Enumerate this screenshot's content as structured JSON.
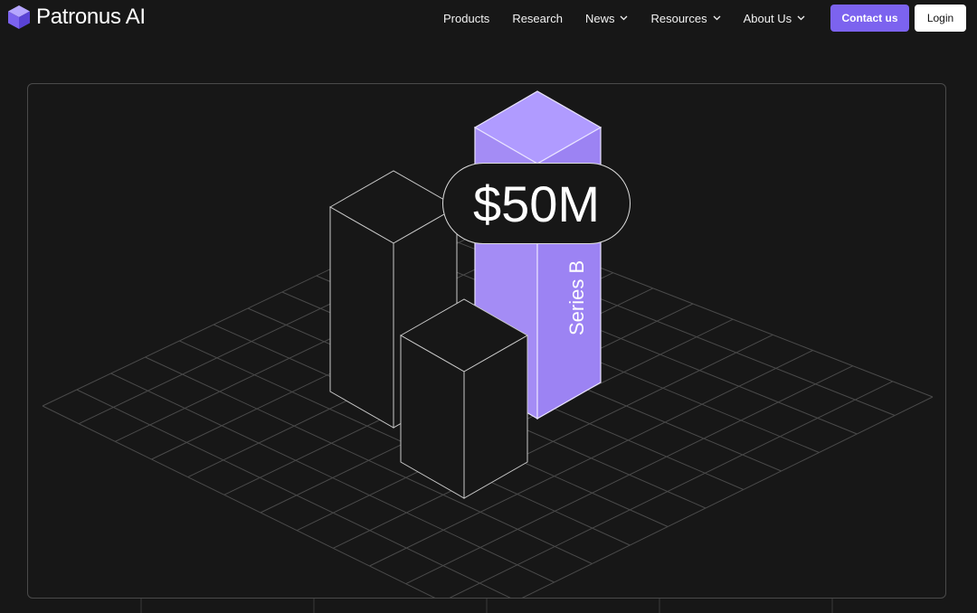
{
  "brand": {
    "name": "Patronus AI",
    "logo_icon": "purple-cube-icon",
    "accent_color": "#7c63ef"
  },
  "nav": {
    "items": [
      {
        "label": "Products",
        "has_dropdown": false
      },
      {
        "label": "Research",
        "has_dropdown": false
      },
      {
        "label": "News",
        "has_dropdown": true
      },
      {
        "label": "Resources",
        "has_dropdown": true
      },
      {
        "label": "About Us",
        "has_dropdown": true
      }
    ],
    "contact_label": "Contact us",
    "login_label": "Login"
  },
  "hero": {
    "amount": "$50M",
    "round_label": "Series B",
    "highlight_color": "#a48cf5",
    "background_color": "#171717"
  }
}
